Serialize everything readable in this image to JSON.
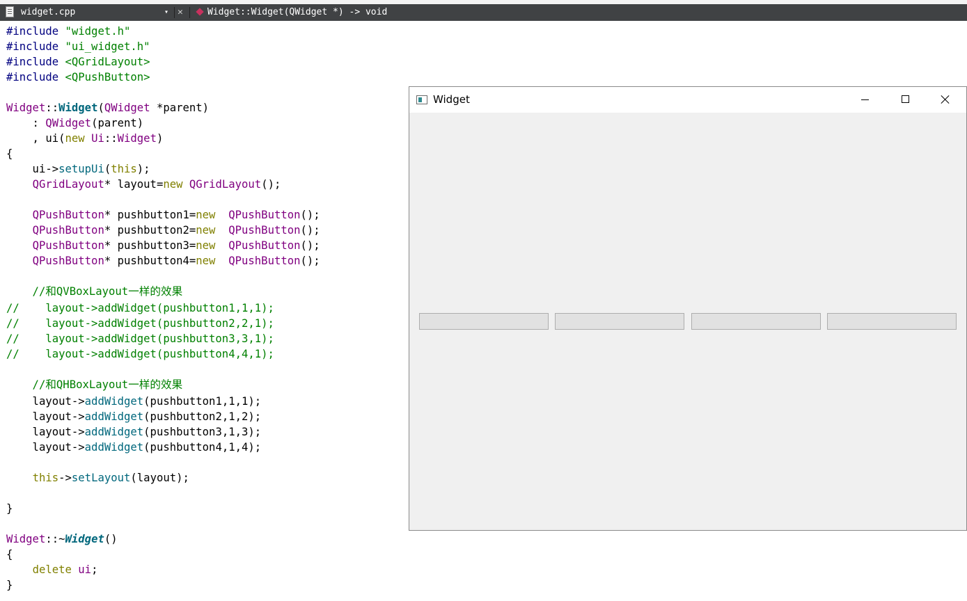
{
  "tabbar": {
    "file_name": "widget.cpp",
    "dropdown_glyph": "▾",
    "close_glyph": "✕",
    "symbol": "Widget::Widget(QWidget *) -> void"
  },
  "code": {
    "l1": [
      "#include ",
      "\"widget.h\""
    ],
    "l2": [
      "#include ",
      "\"ui_widget.h\""
    ],
    "l3": [
      "#include ",
      "<QGridLayout>"
    ],
    "l4": [
      "#include ",
      "<QPushButton>"
    ],
    "l6": [
      "Widget",
      "::",
      "Widget",
      "(",
      "QWidget",
      " *parent)"
    ],
    "l7": [
      "    : ",
      "QWidget",
      "(parent)"
    ],
    "l8": [
      "    , ui(",
      "new",
      " ",
      "Ui",
      "::",
      "Widget",
      ")"
    ],
    "l9": "{",
    "l10": [
      "    ui->",
      "setupUi",
      "(",
      "this",
      ");"
    ],
    "l11": [
      "    ",
      "QGridLayout",
      "* layout=",
      "new",
      " ",
      "QGridLayout",
      "();"
    ],
    "pb1": [
      "    ",
      "QPushButton",
      "* pushbutton1=",
      "new",
      "  ",
      "QPushButton",
      "();"
    ],
    "pb2": [
      "    ",
      "QPushButton",
      "* pushbutton2=",
      "new",
      "  ",
      "QPushButton",
      "();"
    ],
    "pb3": [
      "    ",
      "QPushButton",
      "* pushbutton3=",
      "new",
      "  ",
      "QPushButton",
      "();"
    ],
    "pb4": [
      "    ",
      "QPushButton",
      "* pushbutton4=",
      "new",
      "  ",
      "QPushButton",
      "();"
    ],
    "c_vbox": "    //和QVBoxLayout一样的效果",
    "cv1": "//    layout->addWidget(pushbutton1,1,1);",
    "cv2": "//    layout->addWidget(pushbutton2,2,1);",
    "cv3": "//    layout->addWidget(pushbutton3,3,1);",
    "cv4": "//    layout->addWidget(pushbutton4,4,1);",
    "c_hbox": "    //和QHBoxLayout一样的效果",
    "a1": [
      "    layout->",
      "addWidget",
      "(pushbutton1,1,1);"
    ],
    "a2": [
      "    layout->",
      "addWidget",
      "(pushbutton2,1,2);"
    ],
    "a3": [
      "    layout->",
      "addWidget",
      "(pushbutton3,1,3);"
    ],
    "a4": [
      "    layout->",
      "addWidget",
      "(pushbutton4,1,4);"
    ],
    "set": [
      "    ",
      "this",
      "->",
      "setLayout",
      "(layout);"
    ],
    "close1": "}",
    "dtor": [
      "Widget",
      "::~",
      "Widget",
      "()"
    ],
    "open2": "{",
    "del": [
      "    ",
      "delete",
      " ",
      "ui",
      ";"
    ],
    "close2": "}"
  },
  "window": {
    "title": "Widget",
    "buttons": [
      "",
      "",
      "",
      ""
    ]
  }
}
